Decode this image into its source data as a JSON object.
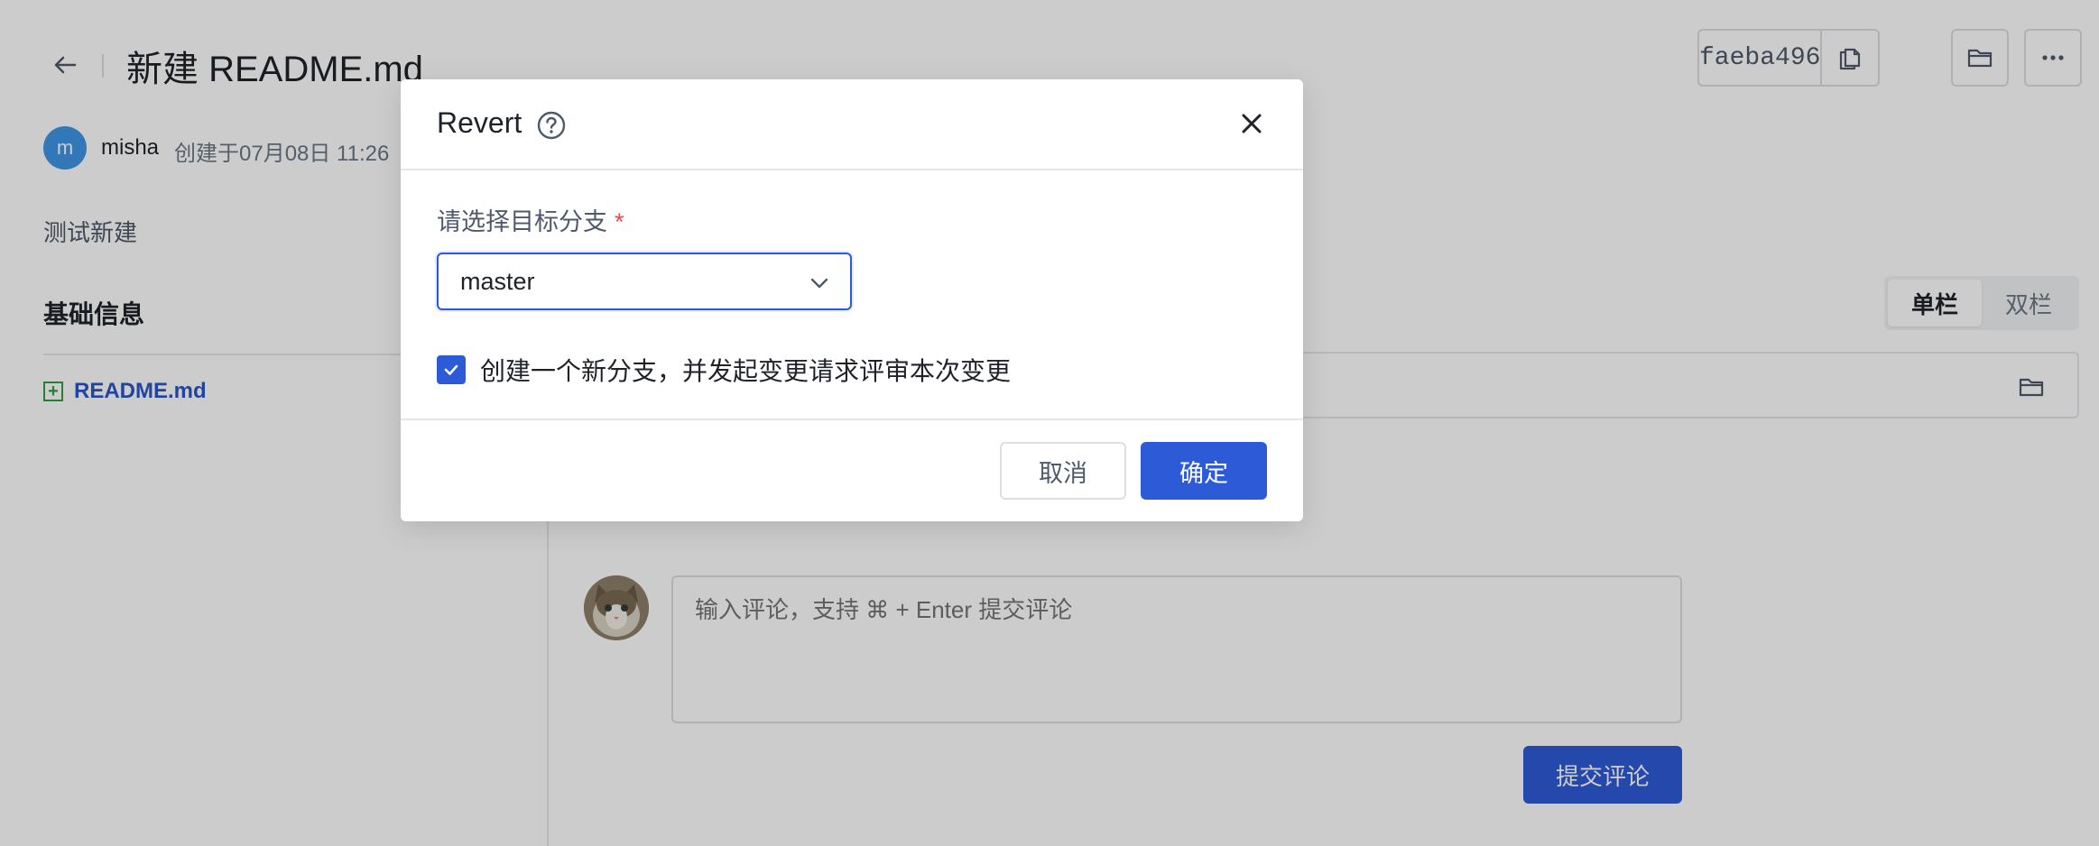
{
  "page": {
    "title": "新建 README.md",
    "commit_hash": "faeba496",
    "author": {
      "initial": "m",
      "name": "misha",
      "created_text": "创建于07月08日 11:26"
    },
    "description": "测试新建",
    "section_title": "基础信息",
    "files": [
      {
        "name": "README.md",
        "status": "added"
      }
    ],
    "view_toggle": {
      "options": [
        "单栏",
        "双栏"
      ],
      "selected": "单栏"
    },
    "comment": {
      "placeholder": "输入评论，支持 ⌘ + Enter 提交评论",
      "submit_label": "提交评论"
    }
  },
  "modal": {
    "title": "Revert",
    "field_label": "请选择目标分支",
    "required_mark": "*",
    "selected_branch": "master",
    "checkbox": {
      "checked": true,
      "label": "创建一个新分支，并发起变更请求评审本次变更"
    },
    "cancel_label": "取消",
    "confirm_label": "确定"
  },
  "colors": {
    "primary": "#2d5bd7",
    "overlay": "rgba(0,0,0,0.20)",
    "added_green": "#2ea043",
    "avatar_blue": "#3f97e6"
  },
  "icons": [
    "back-arrow-icon",
    "copy-icon",
    "folder-icon",
    "more-icon",
    "help-icon",
    "close-icon",
    "chevron-down-icon",
    "check-icon",
    "file-added-icon"
  ]
}
